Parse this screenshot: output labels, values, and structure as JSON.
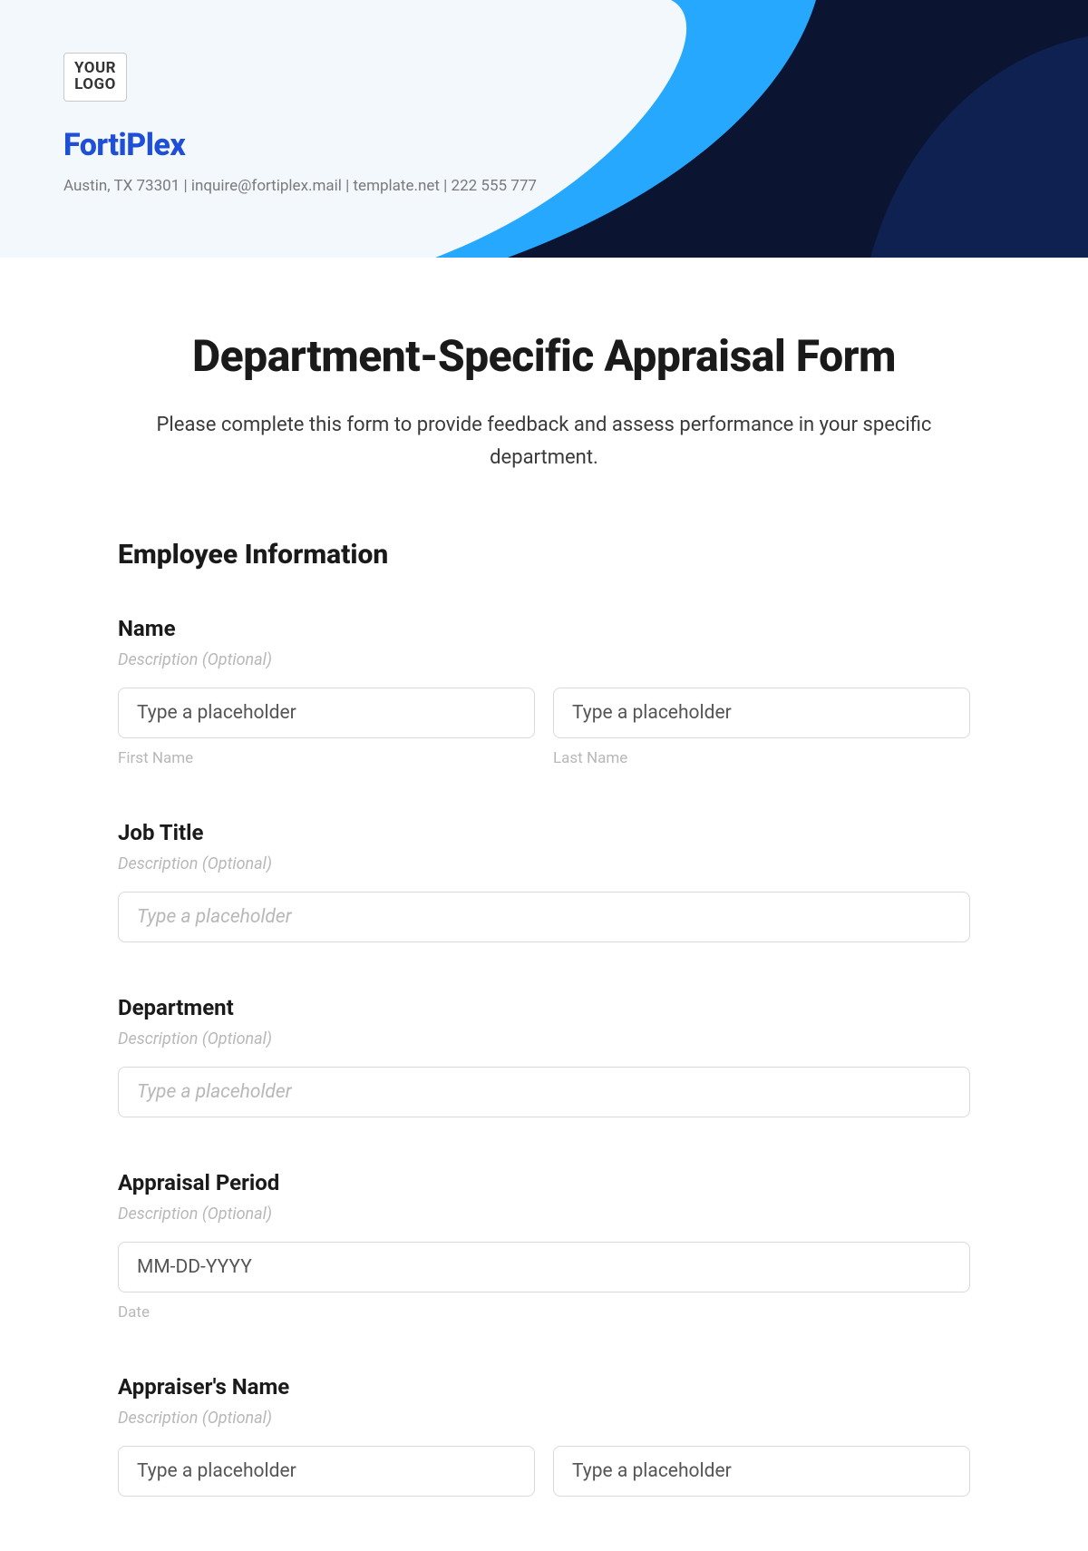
{
  "header": {
    "logo_text": "YOUR\nLOGO",
    "brand": "FortiPlex",
    "contact_line": "Austin, TX 73301 | inquire@fortiplex.mail | template.net | 222 555 777"
  },
  "form": {
    "title": "Department-Specific Appraisal Form",
    "intro": "Please complete this form to provide feedback and assess performance in your specific department.",
    "section_employee_info": "Employee Information",
    "fields": {
      "name": {
        "label": "Name",
        "desc": "Description (Optional)",
        "first_placeholder": "Type a placeholder",
        "first_caption": "First Name",
        "last_placeholder": "Type a placeholder",
        "last_caption": "Last Name"
      },
      "job_title": {
        "label": "Job Title",
        "desc": "Description (Optional)",
        "placeholder": "Type a placeholder"
      },
      "department": {
        "label": "Department",
        "desc": "Description (Optional)",
        "placeholder": "Type a placeholder"
      },
      "appraisal_period": {
        "label": "Appraisal Period",
        "desc": "Description (Optional)",
        "placeholder": "MM-DD-YYYY",
        "caption": "Date"
      },
      "appraiser": {
        "label": "Appraiser's Name",
        "desc": "Description (Optional)",
        "first_placeholder": "Type a placeholder",
        "last_placeholder": "Type a placeholder"
      }
    }
  }
}
